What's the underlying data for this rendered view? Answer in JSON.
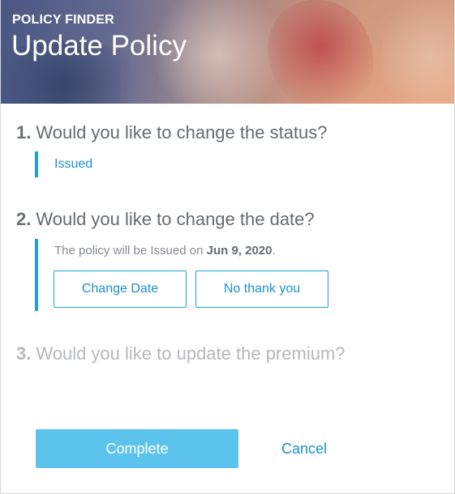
{
  "header": {
    "eyebrow": "POLICY FINDER",
    "title": "Update Policy"
  },
  "questions": [
    {
      "number": "1.",
      "text": "Would you like to change the status?",
      "answer": "Issued"
    },
    {
      "number": "2.",
      "text": "Would you like to change the date?",
      "note_prefix": "The policy will be Issued on ",
      "note_date": "Jun 9, 2020",
      "note_suffix": ".",
      "buttons": {
        "change_date": "Change Date",
        "no_thanks": "No thank you"
      }
    },
    {
      "number": "3.",
      "text": "Would you like to update the premium?",
      "disabled": true
    }
  ],
  "footer": {
    "complete_label": "Complete",
    "cancel_label": "Cancel"
  },
  "colors": {
    "accent": "#1ea1da",
    "primary_button": "#5cc3ec",
    "text_dark": "#666a70",
    "text_disabled": "#b6b8bb"
  }
}
